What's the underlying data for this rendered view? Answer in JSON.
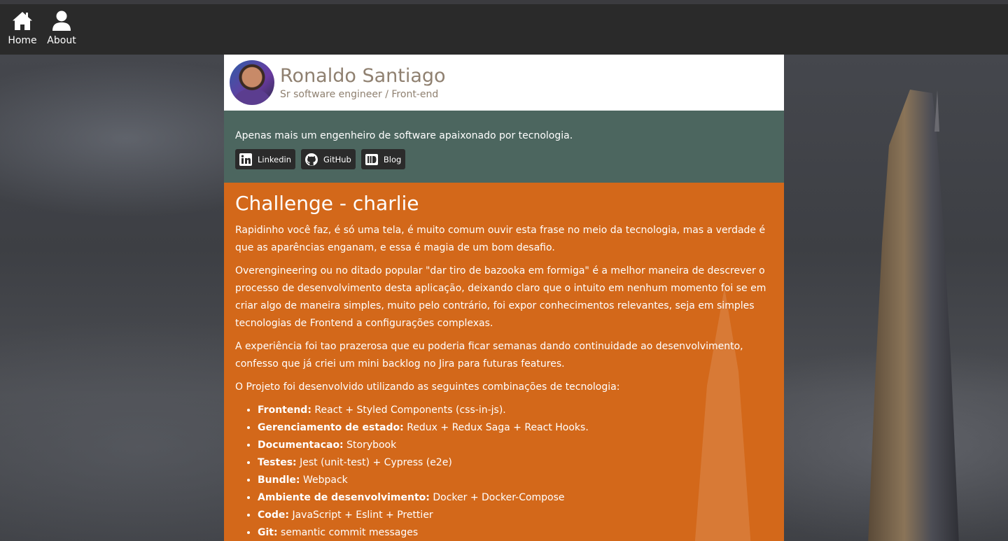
{
  "nav": {
    "items": [
      {
        "label": "Home",
        "icon": "home-icon"
      },
      {
        "label": "About",
        "icon": "user-icon"
      }
    ]
  },
  "profile": {
    "name": "Ronaldo Santiago",
    "role": "Sr software engineer / Front-end"
  },
  "intro": {
    "text": "Apenas mais um engenheiro de software apaixonado por tecnologia.",
    "links": [
      {
        "label": "Linkedin",
        "icon": "linkedin-icon"
      },
      {
        "label": "GitHub",
        "icon": "github-icon"
      },
      {
        "label": "Blog",
        "icon": "blog-icon"
      }
    ]
  },
  "content": {
    "title": "Challenge - charlie",
    "paragraphs": [
      "Rapidinho você faz, é só uma tela, é muito comum ouvir esta frase no meio da tecnologia, mas a verdade é que as aparências enganam, e essa é magia de um bom desafio.",
      "Overengineering ou no ditado popular \"dar tiro de bazooka em formiga\" é a melhor maneira de descrever o processo de desenvolvimento desta aplicação, deixando claro que o intuito em nenhum momento foi se em criar algo de maneira simples, muito pelo contrário, foi expor conhecimentos relevantes, seja em simples tecnologias de Frontend a configurações complexas.",
      "A experiência foi tao prazerosa que eu poderia ficar semanas dando continuidade ao desenvolvimento, confesso que já criei um mini backlog no Jira para futuras features.",
      "O Projeto foi desenvolvido utilizando as seguintes combinações de tecnologia:"
    ],
    "tech_list": [
      {
        "key": "Frontend:",
        "value": "React + Styled Components (css-in-js)."
      },
      {
        "key": "Gerenciamento de estado:",
        "value": "Redux + Redux Saga + React Hooks."
      },
      {
        "key": "Documentacao:",
        "value": "Storybook"
      },
      {
        "key": "Testes:",
        "value": "Jest (unit-test) + Cypress (e2e)"
      },
      {
        "key": "Bundle:",
        "value": "Webpack"
      },
      {
        "key": "Ambiente de desenvolvimento:",
        "value": "Docker + Docker-Compose"
      },
      {
        "key": "Code:",
        "value": "JavaScript + Eslint + Prettier"
      },
      {
        "key": "Git:",
        "value": "semantic commit messages"
      }
    ]
  },
  "colors": {
    "navbar": "#2a2a2a",
    "intro_bg": "#4c665f",
    "content_bg": "#d3681a",
    "name_text": "#8f8070"
  }
}
